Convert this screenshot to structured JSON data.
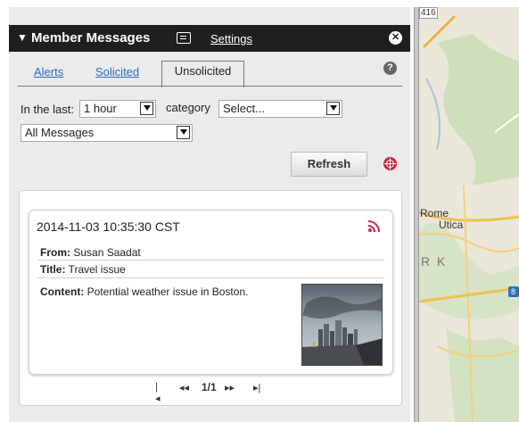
{
  "panel": {
    "title": "Member Messages",
    "settings_label": "Settings",
    "tabs": [
      {
        "label": "Alerts",
        "active": false
      },
      {
        "label": "Solicited",
        "active": false
      },
      {
        "label": "Unsolicited",
        "active": true
      }
    ]
  },
  "filters": {
    "in_last_label": "In the last:",
    "in_last_value": "1 hour",
    "category_label": "category",
    "category_value": "Select...",
    "messages_value": "All Messages"
  },
  "refresh_label": "Refresh",
  "message": {
    "timestamp": "2014-11-03 10:35:30 CST",
    "from_label": "From:",
    "from_value": "Susan Saadat",
    "title_label": "Title:",
    "title_value": "Travel issue",
    "content_label": "Content:",
    "content_value": "Potential weather issue in Boston."
  },
  "pager": {
    "first": "⏮",
    "prev": "◀◀",
    "page": "1/1",
    "next": "▶▶",
    "last": "⏭"
  },
  "map": {
    "road_label": "416",
    "city_1": "Rome",
    "city_2": "Utica",
    "region_fragment": "R K",
    "highway_fragment": "8"
  },
  "colors": {
    "titlebar": "#1f1f1f",
    "link": "#2a6bc3",
    "target_icon": "#c8283c",
    "feed_icon": "#c8283c"
  },
  "icons": [
    "collapse-triangle-icon",
    "message-bubble-icon",
    "close-icon",
    "help-icon",
    "target-icon",
    "rss-feed-icon"
  ]
}
